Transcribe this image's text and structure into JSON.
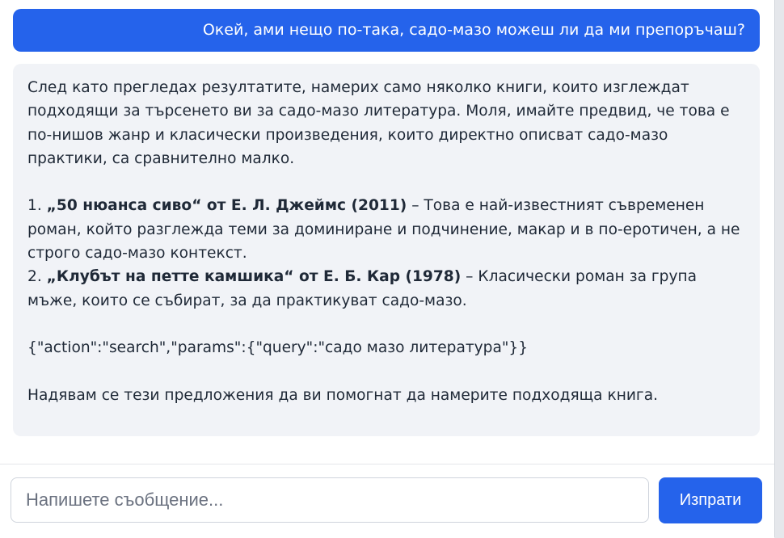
{
  "chat": {
    "user_message": "Окей, ами нещо по-така, садо-мазо можеш ли да ми препоръчаш?",
    "assistant": {
      "intro": "След като прегледах резултатите, намерих само няколко книги, които изглеждат подходящи за търсенето ви за садо-мазо литература. Моля, имайте предвид, че това е по-нишов жанр и класически произведения, които директно описват садо-мазо практики, са сравнително малко.",
      "items": [
        {
          "number": "1.",
          "title": "„50 нюанса сиво“ от Е. Л. Джеймс (2011)",
          "description": " – Това е най-известният съвременен роман, който разглежда теми за доминиране и подчинение, макар и в по-еротичен, а не строго садо-мазо контекст."
        },
        {
          "number": "2.",
          "title": "„Клубът на петте камшика“ от Е. Б. Кар (1978)",
          "description": " – Класически роман за група мъже, които се събират, за да практикуват садо-мазо."
        }
      ],
      "action_json": "{\"action\":\"search\",\"params\":{\"query\":\"садо мазо литература\"}}",
      "closing": "Надявам се тези предложения да ви помогнат да намерите подходяща книга."
    }
  },
  "composer": {
    "placeholder": "Напишете съобщение...",
    "value": "",
    "send_label": "Изпрати"
  },
  "colors": {
    "accent": "#2563eb",
    "assistant_bubble": "#f1f3f7",
    "text": "#1f2937"
  }
}
